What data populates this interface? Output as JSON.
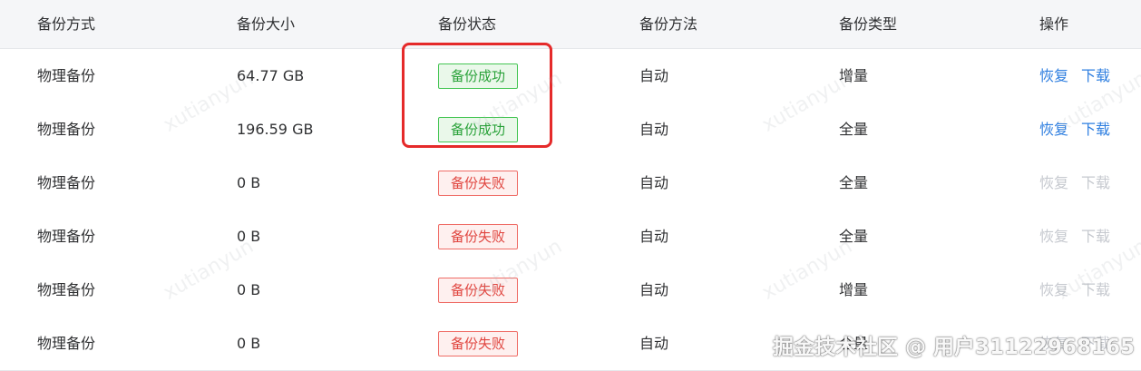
{
  "table": {
    "columns": [
      "备份方式",
      "备份大小",
      "备份状态",
      "备份方法",
      "备份类型",
      "操作"
    ],
    "rows": [
      {
        "mode": "物理备份",
        "size": "64.77 GB",
        "status": "备份成功",
        "status_kind": "success",
        "method": "自动",
        "type": "增量",
        "restore": "恢复",
        "download": "下载",
        "actions_enabled": true
      },
      {
        "mode": "物理备份",
        "size": "196.59 GB",
        "status": "备份成功",
        "status_kind": "success",
        "method": "自动",
        "type": "全量",
        "restore": "恢复",
        "download": "下载",
        "actions_enabled": true
      },
      {
        "mode": "物理备份",
        "size": "0 B",
        "status": "备份失败",
        "status_kind": "fail",
        "method": "自动",
        "type": "全量",
        "restore": "恢复",
        "download": "下载",
        "actions_enabled": false
      },
      {
        "mode": "物理备份",
        "size": "0 B",
        "status": "备份失败",
        "status_kind": "fail",
        "method": "自动",
        "type": "全量",
        "restore": "恢复",
        "download": "下载",
        "actions_enabled": false
      },
      {
        "mode": "物理备份",
        "size": "0 B",
        "status": "备份失败",
        "status_kind": "fail",
        "method": "自动",
        "type": "增量",
        "restore": "恢复",
        "download": "下载",
        "actions_enabled": false
      },
      {
        "mode": "物理备份",
        "size": "0 B",
        "status": "备份失败",
        "status_kind": "fail",
        "method": "自动",
        "type": "全量",
        "restore": "恢复",
        "download": "下载",
        "actions_enabled": false
      }
    ]
  },
  "watermark_text": "xutianyun",
  "footer_watermark": "掘金技术社区 @ 用户3112296816​5",
  "colors": {
    "success": "#2aa23a",
    "fail": "#e0453f",
    "link": "#2f7fe0",
    "link_disabled": "#c6c9cf",
    "highlight": "#e52a2a"
  }
}
